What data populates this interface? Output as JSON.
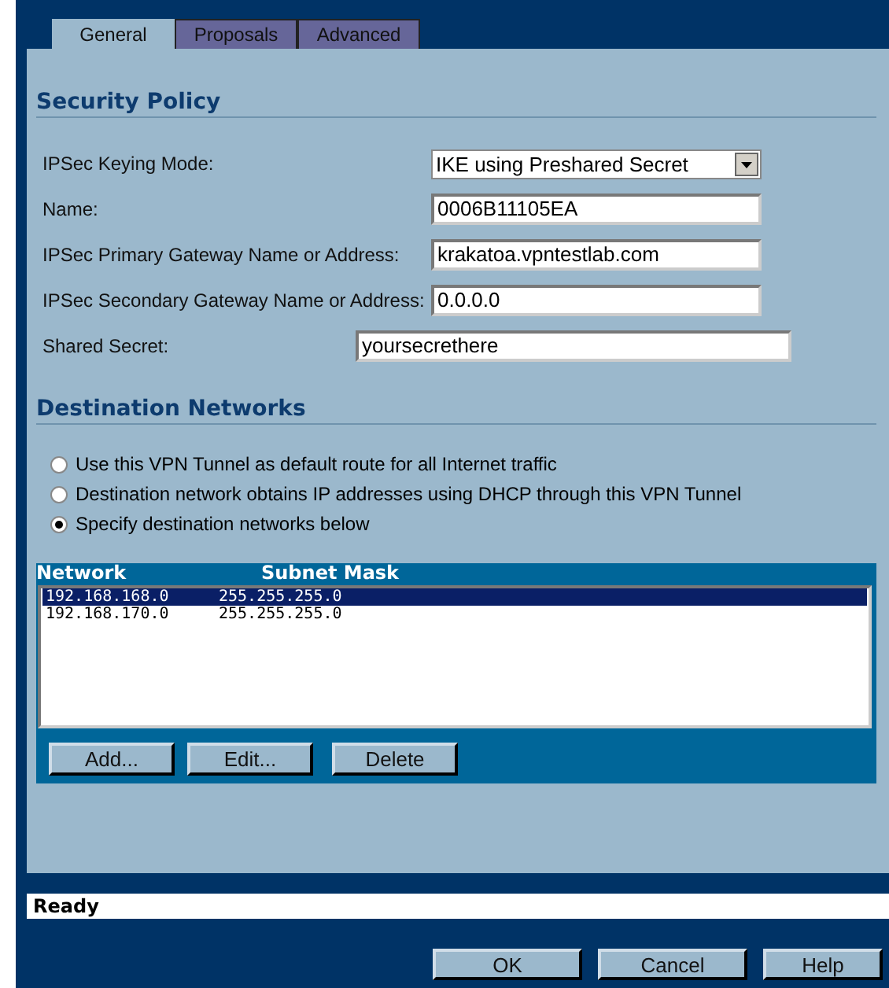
{
  "tabs": [
    {
      "label": "General",
      "selected": true
    },
    {
      "label": "Proposals",
      "selected": false
    },
    {
      "label": "Advanced",
      "selected": false
    }
  ],
  "security_policy": {
    "heading": "Security Policy",
    "fields": [
      {
        "kind": "select",
        "label": "IPSec Keying Mode:",
        "value": "IKE using Preshared Secret"
      },
      {
        "kind": "text",
        "label": "Name:",
        "value": "0006B11105EA"
      },
      {
        "kind": "text",
        "label": "IPSec Primary Gateway Name or Address:",
        "value": "krakatoa.vpntestlab.com"
      },
      {
        "kind": "text",
        "label": "IPSec Secondary Gateway Name or Address:",
        "value": "0.0.0.0"
      },
      {
        "kind": "wide",
        "label": "Shared Secret:",
        "value": "yoursecrethere"
      }
    ]
  },
  "destination_networks": {
    "heading": "Destination Networks",
    "options": [
      {
        "label": "Use this VPN Tunnel as default route for all Internet traffic",
        "selected": false
      },
      {
        "label": "Destination network obtains IP addresses using DHCP through this VPN Tunnel",
        "selected": false
      },
      {
        "label": "Specify destination networks below",
        "selected": true
      }
    ],
    "table": {
      "columns": [
        "Network",
        "Subnet Mask"
      ],
      "rows": [
        {
          "cells": [
            "192.168.168.0",
            "255.255.255.0"
          ],
          "selected": true
        },
        {
          "cells": [
            "192.168.170.0",
            "255.255.255.0"
          ],
          "selected": false
        }
      ]
    },
    "buttons": [
      "Add...",
      "Edit...",
      "Delete"
    ]
  },
  "status_bar": "Ready",
  "buttons": [
    "OK",
    "Cancel",
    "Help"
  ]
}
